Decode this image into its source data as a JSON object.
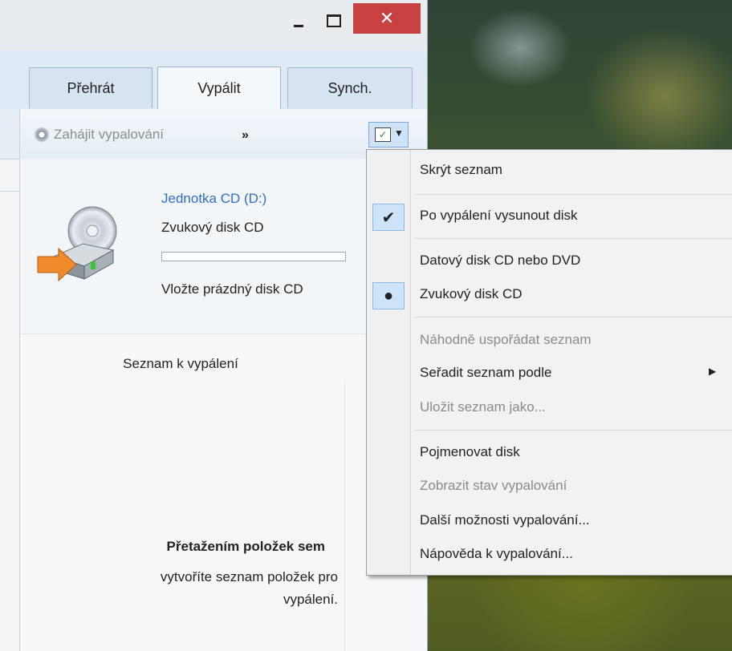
{
  "window": {
    "buttons": {
      "minimize": "–",
      "maximize": "□",
      "close": "✕"
    },
    "tabs": [
      {
        "label": "Přehrát"
      },
      {
        "label": "Vypálit"
      },
      {
        "label": "Synch."
      }
    ],
    "active_tab": "Vypálit"
  },
  "toolbar": {
    "start_burn_label": "Zahájit vypalování",
    "more_label": "»",
    "options_icon": "burn-options-icon"
  },
  "drive": {
    "name": "Jednotka CD (D:)",
    "type": "Zvukový disk CD",
    "hint": "Vložte prázdný disk CD",
    "progress": 0
  },
  "burn_list": {
    "title": "Seznam k vypálení",
    "drop_strong": "Přetažením položek sem",
    "drop_line1": "vytvoříte seznam položek pro",
    "drop_line2": "vypálení."
  },
  "menu": {
    "items": [
      {
        "label": "Skrýt seznam",
        "enabled": true,
        "mark": ""
      },
      {
        "label": "Po vypálení vysunout disk",
        "enabled": true,
        "mark": "✔"
      },
      {
        "label": "Datový disk CD nebo DVD",
        "enabled": true,
        "mark": ""
      },
      {
        "label": "Zvukový disk CD",
        "enabled": true,
        "mark": "●"
      },
      {
        "label": "Náhodně uspořádat seznam",
        "enabled": false,
        "mark": ""
      },
      {
        "label": "Seřadit seznam podle",
        "enabled": true,
        "mark": "",
        "submenu": "▶"
      },
      {
        "label": "Uložit seznam jako...",
        "enabled": false,
        "mark": ""
      },
      {
        "label": "Pojmenovat disk",
        "enabled": true,
        "mark": ""
      },
      {
        "label": "Zobrazit stav vypalování",
        "enabled": false,
        "mark": ""
      },
      {
        "label": "Další možnosti vypalování...",
        "enabled": true,
        "mark": ""
      },
      {
        "label": "Nápověda k vypalování...",
        "enabled": true,
        "mark": ""
      }
    ]
  }
}
